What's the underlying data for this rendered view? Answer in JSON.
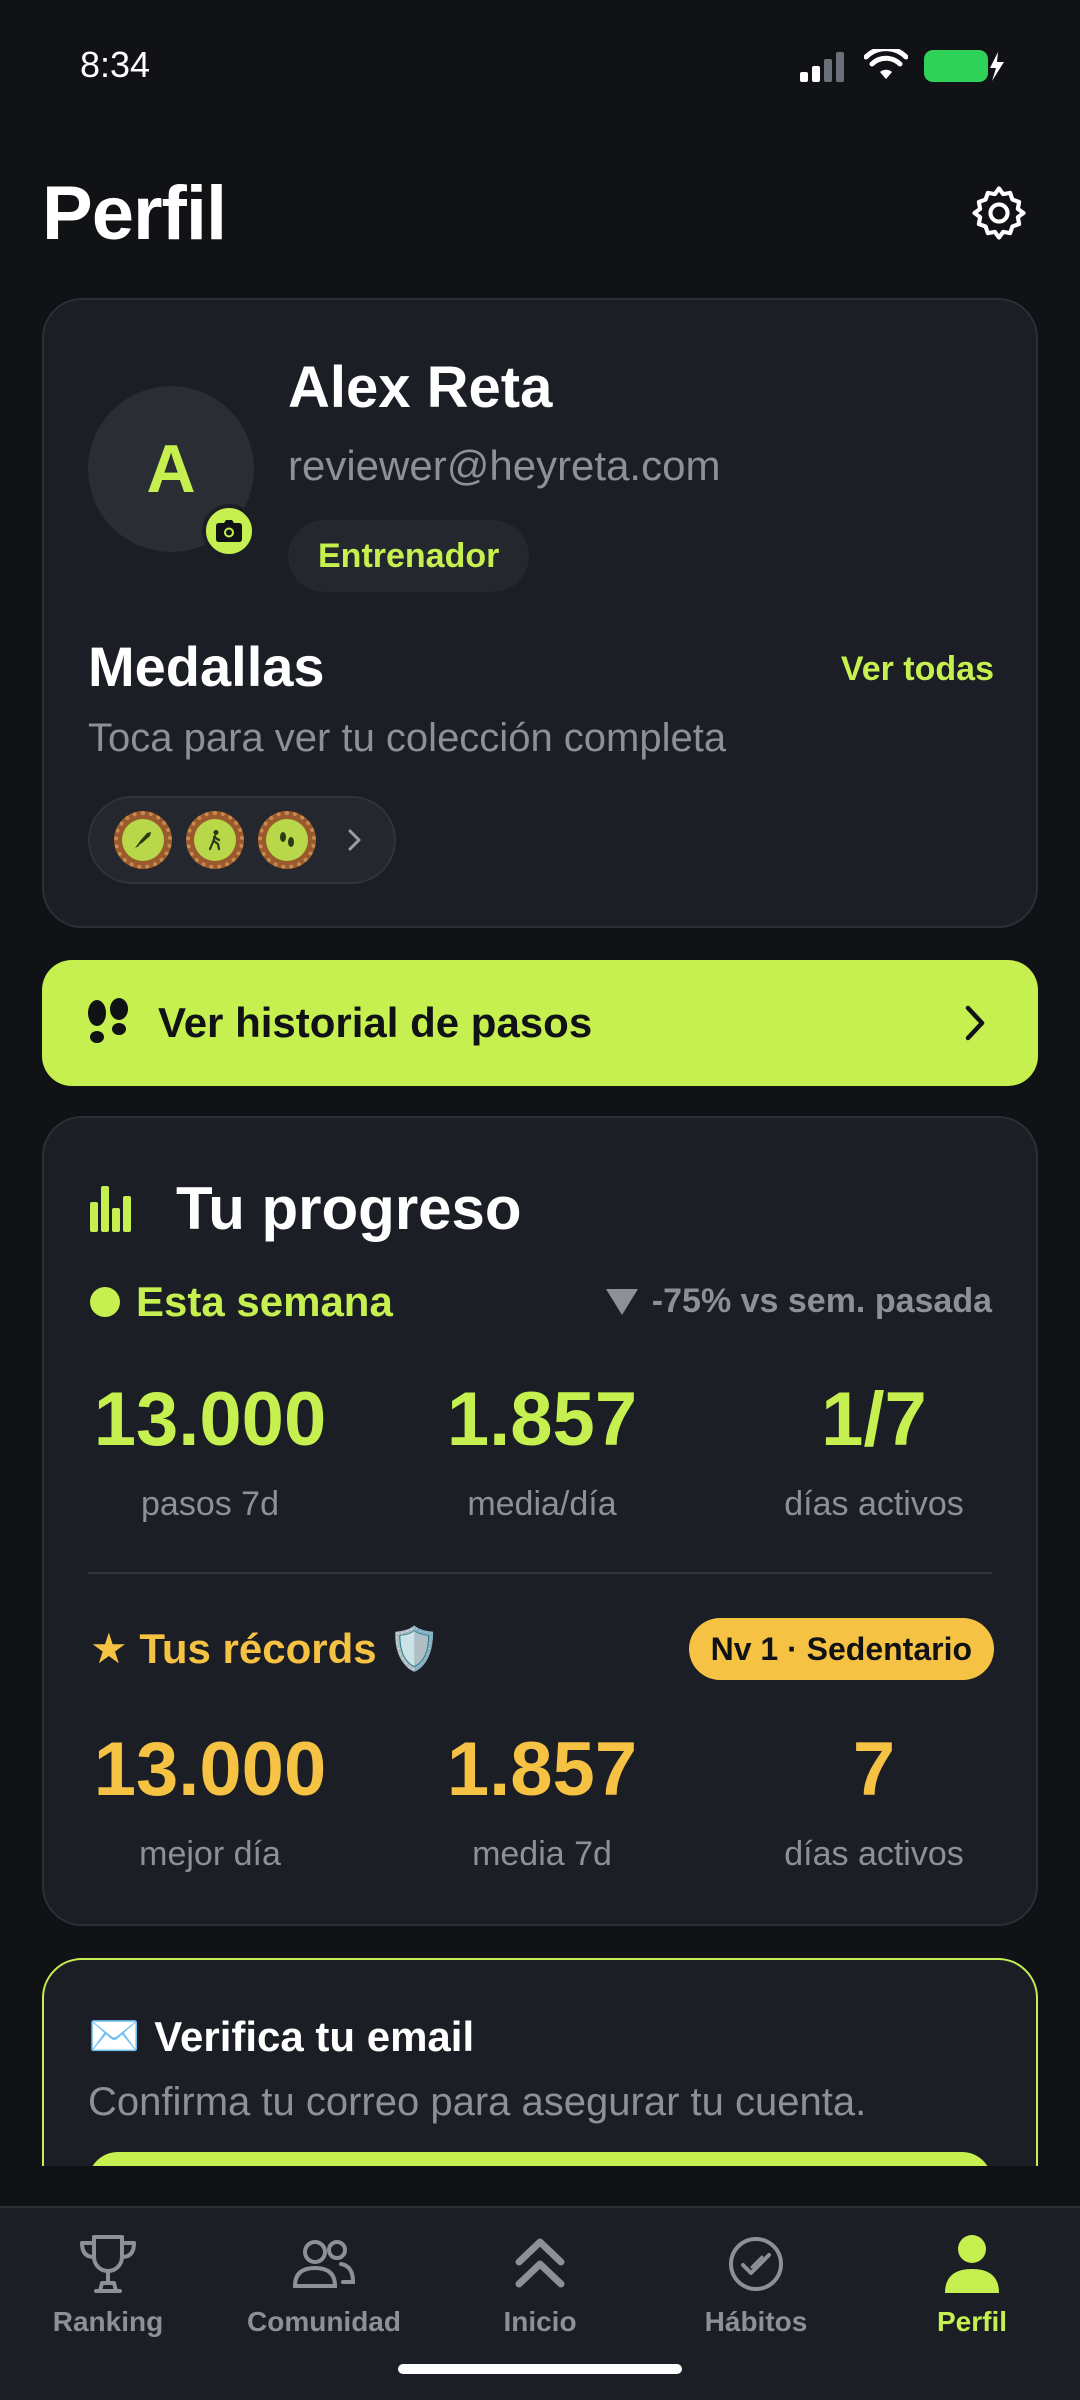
{
  "status_bar": {
    "time": "8:34"
  },
  "header": {
    "title": "Perfil"
  },
  "profile": {
    "avatar_initial": "A",
    "name": "Alex Reta",
    "email": "reviewer@heyreta.com",
    "role": "Entrenador"
  },
  "medals": {
    "title": "Medallas",
    "see_all": "Ver todas",
    "subtitle": "Toca para ver tu colección completa",
    "items": [
      "rocket-medal-icon",
      "walker-medal-icon",
      "footprints-medal-icon"
    ]
  },
  "history_button": {
    "label": "Ver historial de pasos"
  },
  "progress": {
    "title": "Tu progreso",
    "week_label": "Esta semana",
    "delta": "-75% vs sem. pasada",
    "week_stats": [
      {
        "value": "13.000",
        "label": "pasos 7d"
      },
      {
        "value": "1.857",
        "label": "media/día"
      },
      {
        "value": "1/7",
        "label": "días activos"
      }
    ],
    "records_label": "★ Tus récords 🛡️",
    "level": "Nv 1 · Sedentario",
    "record_stats": [
      {
        "value": "13.000",
        "label": "mejor día"
      },
      {
        "value": "1.857",
        "label": "media 7d"
      },
      {
        "value": "7",
        "label": "días activos"
      }
    ]
  },
  "verify": {
    "icon": "✉️",
    "title": "Verifica tu email",
    "text": "Confirma tu correo para asegurar tu cuenta."
  },
  "tabs": [
    {
      "label": "Ranking",
      "icon": "trophy-icon"
    },
    {
      "label": "Comunidad",
      "icon": "community-icon"
    },
    {
      "label": "Inicio",
      "icon": "home-chevrons-icon"
    },
    {
      "label": "Hábitos",
      "icon": "habits-check-icon"
    },
    {
      "label": "Perfil",
      "icon": "profile-icon",
      "active": true
    }
  ],
  "colors": {
    "accent": "#c6f04f",
    "gold": "#f6c244",
    "background": "#101216",
    "card": "#1b1e24"
  }
}
